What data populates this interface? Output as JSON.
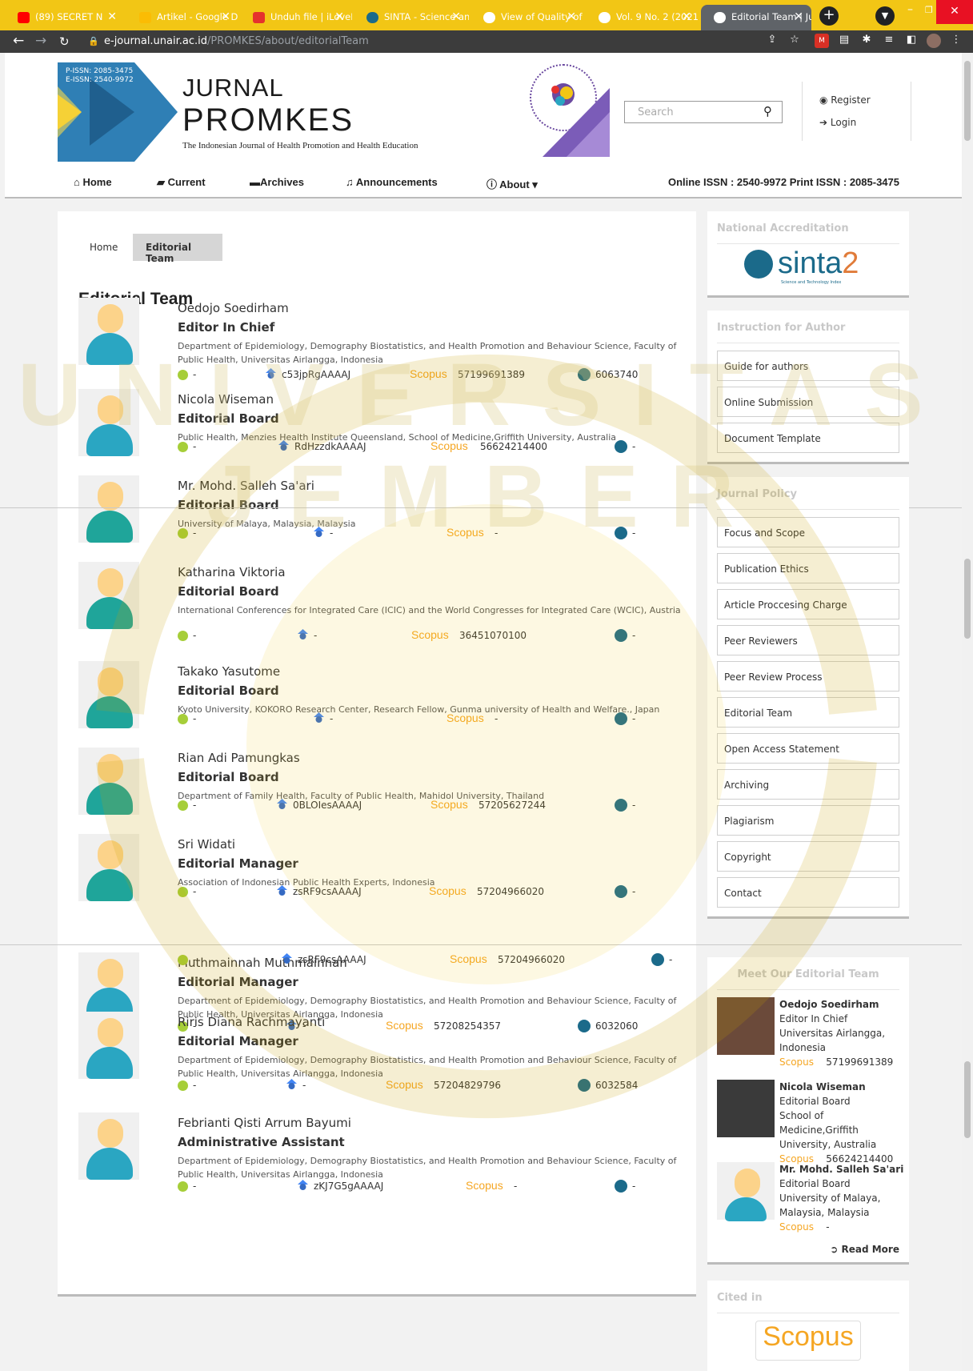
{
  "browser": {
    "tabs": [
      {
        "title": "(89) SECRET N",
        "color": "#ff0000"
      },
      {
        "title": "Artikel - Google D",
        "color": "#fbbc04"
      },
      {
        "title": "Unduh file | iLoveF",
        "color": "#e5322d"
      },
      {
        "title": "SINTA - Science an",
        "color": "#1b6a8a"
      },
      {
        "title": "View of Quality of",
        "color": "#ffffff"
      },
      {
        "title": "Vol. 9 No. 2 (2021)",
        "color": "#ffffff"
      },
      {
        "title": "Editorial Team | Ju",
        "color": "#ffffff"
      }
    ],
    "url_host": "e-journal.unair.ac.id",
    "url_path": "/PROMKES/about/editorialTeam"
  },
  "header": {
    "pissn_small": "P-ISSN: 2085-3475",
    "eissn_small": "E-ISSN: 2540-9972",
    "title_line1": "JURNAL",
    "title_line2": "PROMKES",
    "tagline": "The Indonesian Journal of Health Promotion and Health Education",
    "search_placeholder": "Search",
    "register": "Register",
    "login": "Login"
  },
  "nav": {
    "home": "Home",
    "current": "Current",
    "archives": "Archives",
    "announcements": "Announcements",
    "about": "About",
    "issn": "Online ISSN : 2540-9972   Print ISSN : 2085-3475"
  },
  "breadcrumb": {
    "home": "Home",
    "current": "Editorial Team"
  },
  "page_title": "Editorial Team",
  "scopus_label": "Scopus",
  "members": [
    {
      "name": "Oedojo Soedirham",
      "role": "Editor In Chief",
      "affiliation": "Department of Epidemiology, Demography Biostatistics, and Health Promotion and Behaviour Science, Faculty of Public Health, Universitas Airlangga, Indonesia",
      "orcid": "-",
      "gscholar": "c53jpRgAAAAJ",
      "scopus": "57199691389",
      "sinta": "6063740"
    },
    {
      "name": "Nicola Wiseman",
      "role": "Editorial Board",
      "affiliation": "Public Health, Menzies Health Institute Queensland, School of Medicine,Griffith University, Australia",
      "orcid": "-",
      "gscholar": "RdHzzdkAAAAJ",
      "scopus": "56624214400",
      "sinta": "-"
    },
    {
      "name": "Mr. Mohd. Salleh Sa'ari",
      "role": "Editorial Board",
      "affiliation": "University of Malaya, Malaysia, Malaysia",
      "orcid": "-",
      "gscholar": "-",
      "scopus": "-",
      "sinta": "-"
    },
    {
      "name": "Katharina Viktoria",
      "role": "Editorial Board",
      "affiliation": "International Conferences for Integrated Care (ICIC) and the World Congresses for Integrated Care (WCIC), Austria",
      "orcid": "-",
      "gscholar": "-",
      "scopus": "36451070100",
      "sinta": "-"
    },
    {
      "name": "Takako Yasutome",
      "role": "Editorial Board",
      "affiliation": "Kyoto University, KOKORO Research Center, Research Fellow, Gunma university of Health and Welfare., Japan",
      "orcid": "-",
      "gscholar": "-",
      "scopus": "-",
      "sinta": "-"
    },
    {
      "name": "Rian Adi Pamungkas",
      "role": "Editorial Board",
      "affiliation": "Department of Family Health, Faculty of Public Health, Mahidol University, Thailand",
      "orcid": "-",
      "gscholar": "0BLOIesAAAAJ",
      "scopus": "57205627244",
      "sinta": "-"
    },
    {
      "name": "Sri Widati",
      "role": "Editorial Manager",
      "affiliation": "Association of Indonesian Public Health Experts, Indonesia",
      "orcid": "-",
      "gscholar": "zsRF9csAAAAJ",
      "scopus": "57204966020",
      "sinta": "-"
    },
    {
      "name": "Muthmainnah Muthmainnah",
      "role": "Editorial Manager",
      "affiliation": "Department of Epidemiology, Demography Biostatistics, and Health Promotion and Behaviour Science, Faculty of Public Health, Universitas Airlangga, Indonesia",
      "orcid": "-",
      "gscholar": "-",
      "scopus": "57208254357",
      "sinta": "6032060"
    },
    {
      "name": "Riris Diana Rachmayanti",
      "role": "Editorial Manager",
      "affiliation": "Department of Epidemiology, Demography Biostatistics, and Health Promotion and Behaviour Science, Faculty of Public Health, Universitas Airlangga, Indonesia",
      "orcid": "-",
      "gscholar": "-",
      "scopus": "57204829796",
      "sinta": "6032584"
    },
    {
      "name": "Febrianti Qisti Arrum Bayumi",
      "role": "Administrative Assistant",
      "affiliation": "Department of Epidemiology, Demography Biostatistics, and Health Promotion and Behaviour Science, Faculty of Public Health, Universitas Airlangga, Indonesia",
      "orcid": "-",
      "gscholar": "zKJ7G5gAAAAJ",
      "scopus": "-",
      "sinta": "-"
    }
  ],
  "duplicate_row": {
    "orcid": "-",
    "gscholar": "zsRF9csAAAAJ",
    "scopus": "57204966020",
    "sinta": "-"
  },
  "sidebar": {
    "accreditation_title": "National Accreditation",
    "sinta_logo": "sinta",
    "sinta_level": "2",
    "sinta_sub": "Science and Technology Index",
    "instruction_title": "Instruction for Author",
    "instruction_links": [
      "Guide for authors",
      "Online Submission",
      "Document Template"
    ],
    "policy_title": "Journal Policy",
    "policy_links": [
      "Focus and Scope",
      "Publication Ethics",
      "Article Proccesing Charge",
      "Peer Reviewers",
      "Peer Review Process",
      "Editorial Team",
      "Open Access Statement",
      "Archiving",
      "Plagiarism",
      "Copyright",
      "Contact"
    ],
    "meet_title": "Meet Our Editorial Team",
    "meet": [
      {
        "name": "Oedojo Soedirham",
        "role": "Editor In Chief",
        "affiliation": "Universitas Airlangga, Indonesia",
        "scopus": "57199691389"
      },
      {
        "name": "Nicola Wiseman",
        "role": "Editorial Board",
        "affiliation": "School of Medicine,Griffith University, Australia",
        "scopus": "56624214400"
      },
      {
        "name": "Mr. Mohd. Salleh Sa'ari",
        "role": "Editorial Board",
        "affiliation": "University of Malaya, Malaysia, Malaysia",
        "scopus": "-"
      }
    ],
    "read_more": "Read More",
    "cited_title": "Cited in",
    "cited_logo": "Scopus"
  },
  "watermark_text": "UNIVERSITAS JEMBER",
  "colors": {
    "accent_yellow": "#f2c615",
    "scopus_orange": "#f5a623",
    "orcid_green": "#a6ce39"
  }
}
